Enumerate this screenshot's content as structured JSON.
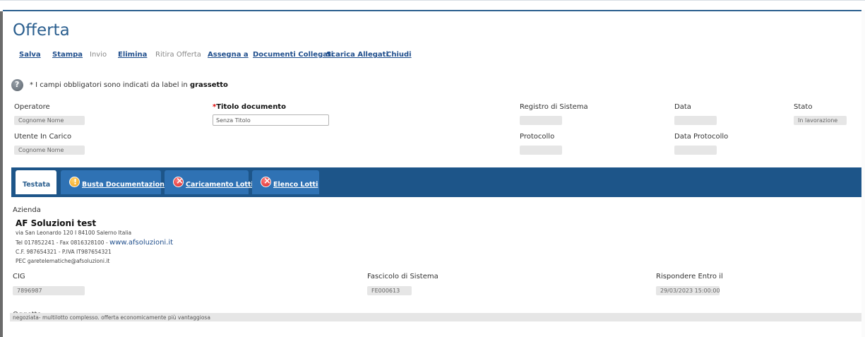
{
  "page": {
    "title": "Offerta"
  },
  "toolbar": {
    "items": [
      {
        "label": "Salva",
        "enabled": true
      },
      {
        "label": "Stampa",
        "enabled": true
      },
      {
        "label": "Invio",
        "enabled": false
      },
      {
        "label": "Elimina",
        "enabled": true
      },
      {
        "label": "Ritira Offerta",
        "enabled": false
      },
      {
        "label": "Assegna a",
        "enabled": true
      },
      {
        "label": "Documenti Collegati",
        "enabled": true
      },
      {
        "label": "Scarica Allegati",
        "enabled": true
      },
      {
        "label": "Chiudi",
        "enabled": true
      }
    ]
  },
  "info": {
    "icon": "help-icon",
    "text": "* I campi obbligatori sono indicati da label in",
    "bold": "grassetto"
  },
  "header": {
    "operatore_label": "Operatore",
    "operatore_value": "Cognome Nome",
    "titolo_required": "*",
    "titolo_label": "Titolo documento",
    "titolo_value": "Senza Titolo",
    "registro_label": "Registro di Sistema",
    "registro_value": "",
    "data_label": "Data",
    "data_value": "",
    "stato_label": "Stato",
    "stato_value": "In lavorazione",
    "utente_label": "Utente In Carico",
    "utente_value": "Cognome Nome",
    "protocollo_label": "Protocollo",
    "protocollo_value": "",
    "data_protocollo_label": "Data Protocollo",
    "data_protocollo_value": ""
  },
  "tabs": [
    {
      "label": "Testata",
      "active": true,
      "icon": ""
    },
    {
      "label": "Busta Documentazione",
      "active": false,
      "icon": "warning-icon"
    },
    {
      "label": "Caricamento Lotti",
      "active": false,
      "icon": "error-icon"
    },
    {
      "label": "Elenco Lotti",
      "active": false,
      "icon": "error-icon"
    }
  ],
  "testata": {
    "azienda_label": "Azienda",
    "azienda_name": "AF Soluzioni test",
    "address": "via San Leonardo 120 I 84100 Salerno Italia",
    "tel": "Tel 017852241 - Fax 0816328100 - ",
    "website": "www.afsoluzioni.it",
    "cf": "C.F. 987654321 - P.IVA IT987654321",
    "pec": "PEC garetelematiche@afsoluzioni.it",
    "cig_label": "CIG",
    "cig_value": "7896987",
    "fascicolo_label": "Fascicolo di Sistema",
    "fascicolo_value": "FE000613",
    "rispondere_label": "Rispondere Entro il",
    "rispondere_value": "29/03/2023 15:00:00",
    "oggetto_label": "Oggetto",
    "oggetto_value": "negoziata- multilotto complesso. offerta economicamente più vantaggiosa"
  },
  "colors": {
    "accent": "#2b5f8f",
    "tabbar": "#1d5589",
    "tab_inactive": "#2f72b4"
  }
}
